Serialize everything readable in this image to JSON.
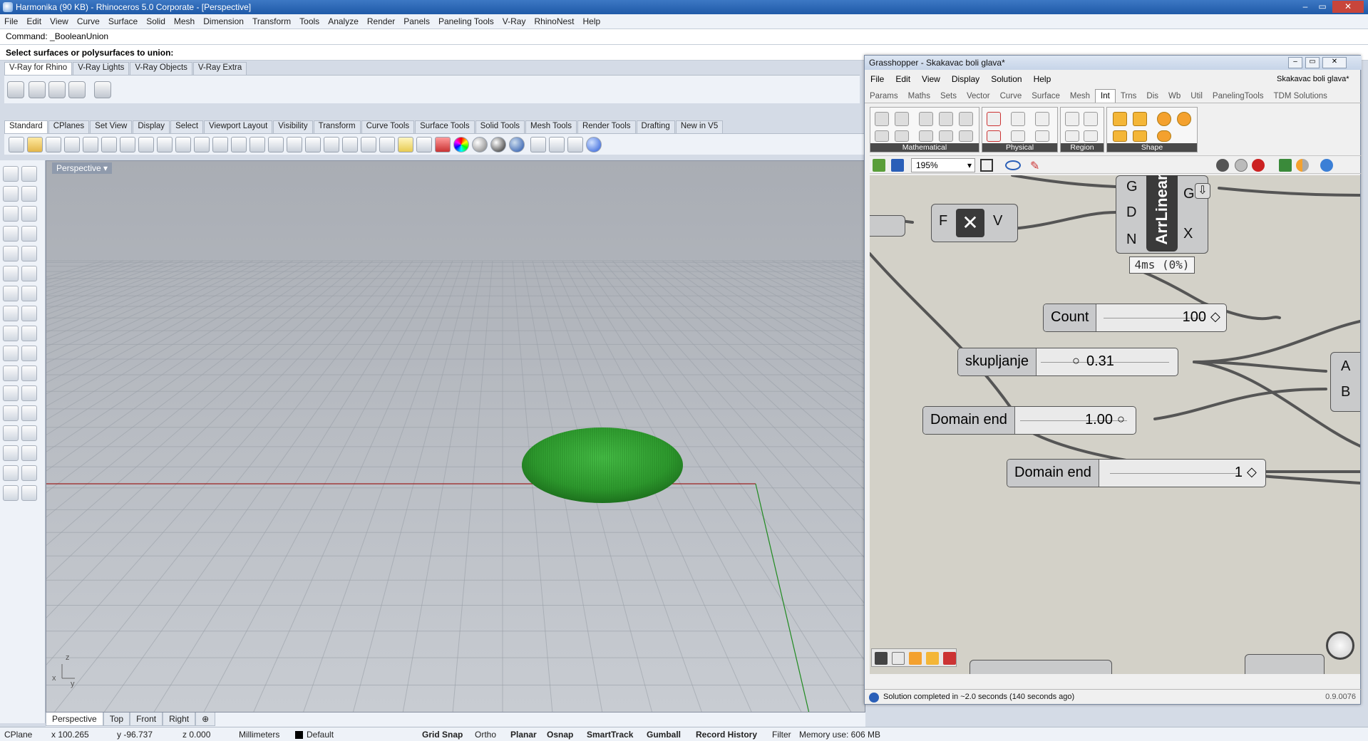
{
  "window": {
    "title": "Harmonika (90 KB) - Rhinoceros  5.0 Corporate - [Perspective]",
    "controls": [
      "–",
      "▭",
      "✕"
    ]
  },
  "menu": [
    "File",
    "Edit",
    "View",
    "Curve",
    "Surface",
    "Solid",
    "Mesh",
    "Dimension",
    "Transform",
    "Tools",
    "Analyze",
    "Render",
    "Panels",
    "Paneling Tools",
    "V-Ray",
    "RhinoNest",
    "Help"
  ],
  "command": {
    "history": "Command: _BooleanUnion",
    "prompt": "Select surfaces or polysurfaces to union:"
  },
  "vray_tabs": [
    "V-Ray for Rhino",
    "V-Ray Lights",
    "V-Ray Objects",
    "V-Ray Extra"
  ],
  "std_tabs": [
    "Standard",
    "CPlanes",
    "Set View",
    "Display",
    "Select",
    "Viewport Layout",
    "Visibility",
    "Transform",
    "Curve Tools",
    "Surface Tools",
    "Solid Tools",
    "Mesh Tools",
    "Render Tools",
    "Drafting",
    "New in V5"
  ],
  "viewport": {
    "label": "Perspective",
    "dropdown": "▾",
    "axis_labels": {
      "z": "z",
      "y": "y",
      "x": "x"
    },
    "object_color": "#2e9a2e"
  },
  "viewport_tabs": [
    "Perspective",
    "Top",
    "Front",
    "Right",
    "⊕"
  ],
  "status": {
    "cplane": "CPlane",
    "x": "x 100.265",
    "y": "y -96.737",
    "z": "z 0.000",
    "units": "Millimeters",
    "layer": "Default",
    "toggles": [
      "Grid Snap",
      "Ortho",
      "Planar",
      "Osnap",
      "SmartTrack",
      "Gumball",
      "Record History",
      "Filter"
    ],
    "bold_toggles": [
      "Grid Snap",
      "Planar",
      "Osnap",
      "SmartTrack",
      "Gumball",
      "Record History"
    ],
    "memory": "Memory use: 606 MB"
  },
  "grasshopper": {
    "title": "Grasshopper - Skakavac boli glava*",
    "doc_name": "Skakavac boli glava*",
    "menu": [
      "File",
      "Edit",
      "View",
      "Display",
      "Solution",
      "Help"
    ],
    "tabs": [
      "Params",
      "Maths",
      "Sets",
      "Vector",
      "Curve",
      "Surface",
      "Mesh",
      "Int",
      "Trns",
      "Dis",
      "Wb",
      "Util",
      "PanelingTools",
      "TDM Solutions"
    ],
    "active_tab": "Int",
    "ribbon_groups": [
      "Mathematical",
      "Physical",
      "Region",
      "Shape"
    ],
    "zoom": "195%",
    "canvas": {
      "xnode": {
        "in": "F",
        "out": "V",
        "symbol": "✕"
      },
      "arrlinear": {
        "name": "ArrLinear",
        "inputs": [
          "G",
          "D",
          "N"
        ],
        "outputs": [
          "G",
          "X"
        ],
        "time": "4ms  (0%)"
      },
      "sliders": [
        {
          "name": "Count",
          "value": "100",
          "marker": "◇"
        },
        {
          "name": "skupljanje",
          "value": "0.31",
          "marker": "○"
        },
        {
          "name": "Domain end",
          "value": "1.00",
          "marker": "○"
        },
        {
          "name": "Domain end",
          "value": "1",
          "marker": "◇"
        }
      ],
      "ab_inputs": [
        "A",
        "B"
      ]
    },
    "status": "Solution completed in ~2.0 seconds (140 seconds ago)",
    "version": "0.9.0076"
  }
}
